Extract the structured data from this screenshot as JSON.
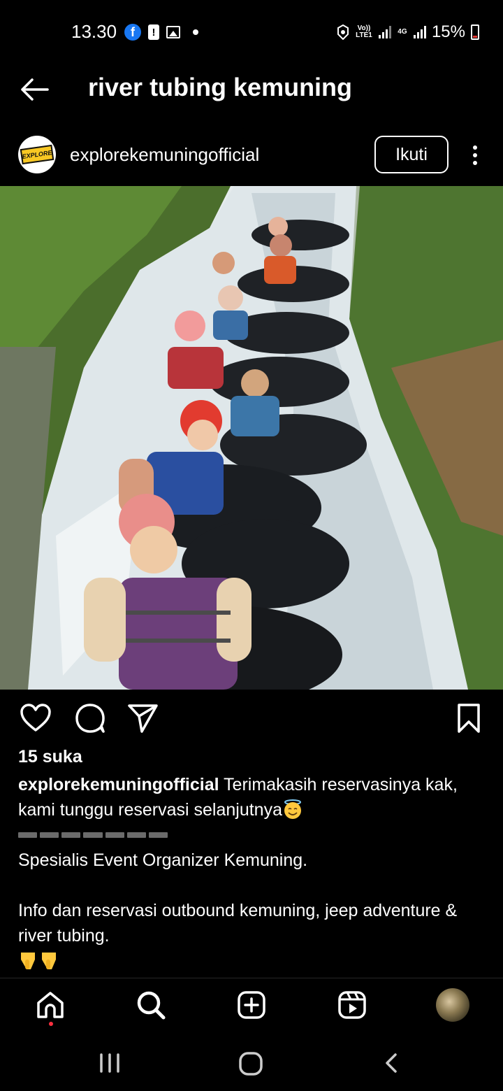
{
  "status_bar": {
    "time": "13.30",
    "network_label": "Vo)) LTE1",
    "network_type": "4G",
    "battery": "15%"
  },
  "header": {
    "title": "river tubing kemuning"
  },
  "post": {
    "username": "explorekemuningofficial",
    "avatar_text": "EXPLORE",
    "follow_label": "Ikuti",
    "likes": "15 suka",
    "caption_user": "explorekemuningofficial",
    "caption_text": " Terimakasih reservasinya kak, kami tunggu reservasi selanjutnya",
    "body_line1": "Spesialis Event Organizer Kemuning.",
    "body_line2": "Info dan reservasi outbound kemuning, jeep adventure & river tubing."
  },
  "icons": {
    "back": "arrow-left-icon",
    "like": "heart-icon",
    "comment": "comment-icon",
    "share": "send-icon",
    "save": "bookmark-icon",
    "home": "home-icon",
    "search": "search-icon",
    "create": "plus-square-icon",
    "reels": "reels-icon"
  },
  "colors": {
    "background": "#000000",
    "text": "#ffffff",
    "notification_dot": "#ff3040"
  }
}
